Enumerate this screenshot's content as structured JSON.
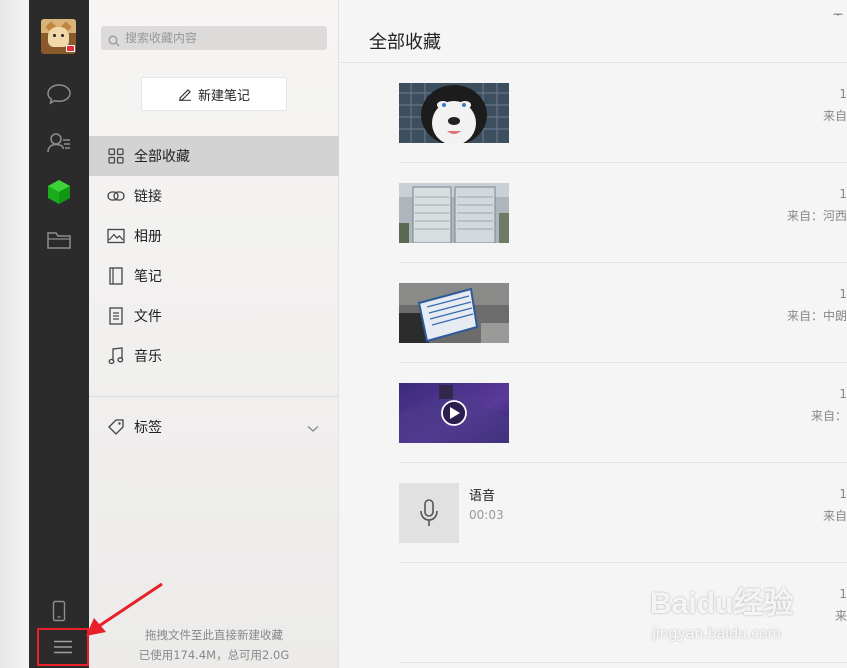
{
  "search": {
    "placeholder": "搜索收藏内容"
  },
  "toolbar": {
    "new_note_label": "新建笔记"
  },
  "sidebar": {
    "items": [
      {
        "label": "全部收藏",
        "icon": "grid-icon",
        "active": true
      },
      {
        "label": "链接",
        "icon": "link-icon"
      },
      {
        "label": "相册",
        "icon": "image-icon"
      },
      {
        "label": "笔记",
        "icon": "notebook-icon"
      },
      {
        "label": "文件",
        "icon": "file-icon"
      },
      {
        "label": "音乐",
        "icon": "music-icon"
      }
    ],
    "tags_label": "标签",
    "drop_hint": "拖拽文件至此直接新建收藏",
    "storage": "已使用174.4M，总可用2.0G"
  },
  "main": {
    "title": "全部收藏",
    "pin_glyph": "ᅮ",
    "items": [
      {
        "type": "image",
        "thumb": "husky-photo",
        "date": "1",
        "source": "来自"
      },
      {
        "type": "image",
        "thumb": "timetable-board-photo",
        "date": "1",
        "source": "来自：河西"
      },
      {
        "type": "image",
        "thumb": "desk-sign-photo",
        "date": "1",
        "source": "来自：中朗"
      },
      {
        "type": "video",
        "thumb": "night-video",
        "date": "1",
        "source": "来自："
      },
      {
        "type": "voice",
        "title": "语音",
        "duration": "00:03",
        "date": "1",
        "source": "来自"
      },
      {
        "type": "partial",
        "date": "1",
        "source": "来"
      }
    ]
  },
  "watermark": {
    "brand": "Baidu经验",
    "url": "jingyan.baidu.com"
  },
  "colors": {
    "rail_bg": "#2b2b2b",
    "accent_green": "#1aad19",
    "highlight_red": "#e8202a"
  }
}
